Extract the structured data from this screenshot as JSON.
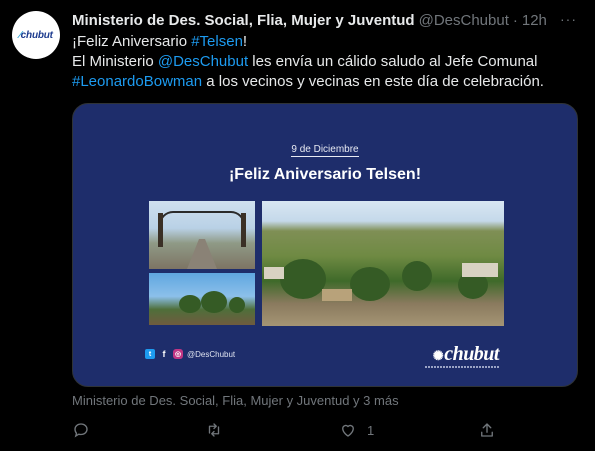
{
  "tweet": {
    "author_name": "Ministerio de Des. Social, Flia, Mujer y Juventud",
    "handle": "@DesChubut",
    "dot": "·",
    "time": "12h",
    "more": "···",
    "avatar_text": "chubut",
    "line1_prefix": "¡Feliz Aniversario ",
    "line1_hashtag": "#Telsen",
    "line1_suffix": "!",
    "line2_prefix": "El Ministerio ",
    "line2_mention": "@DesChubut",
    "line2_suffix": " les envía un cálido saludo al Jefe Comunal",
    "line3_hashtag": "#LeonardoBowman",
    "line3_suffix": " a los vecinos y vecinas en este día de celebración.",
    "tagged_users": "Ministerio de Des. Social, Flia, Mujer y Juventud y 3 más"
  },
  "card": {
    "date": "9 de Diciembre",
    "title": "¡Feliz Aniversario Telsen!",
    "social_handle": "@DesChubut",
    "brand": "chubut"
  },
  "actions": {
    "reply_icon": "reply-icon",
    "retweet_icon": "retweet-icon",
    "like_icon": "heart-icon",
    "like_count": "1",
    "share_icon": "share-icon"
  },
  "colors": {
    "background": "#000000",
    "link": "#1d9bf0",
    "card_background": "#1e2d6b",
    "muted": "#71767b"
  }
}
